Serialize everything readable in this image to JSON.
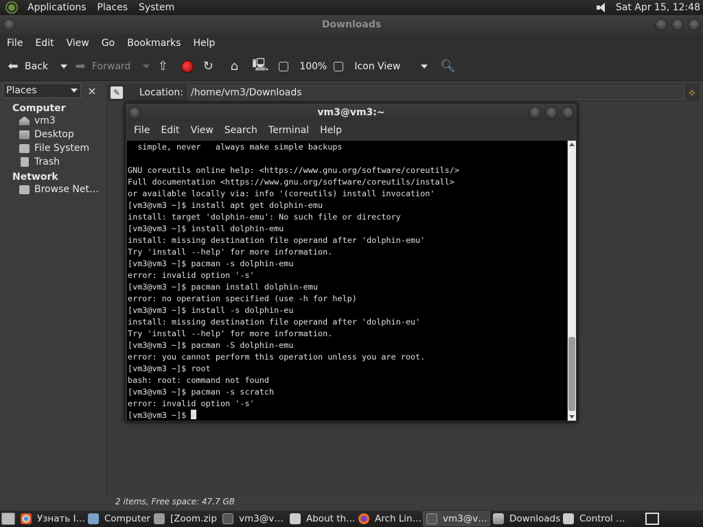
{
  "top_panel": {
    "menus": [
      "Applications",
      "Places",
      "System"
    ],
    "clock": "Sat Apr 15, 12:48"
  },
  "file_manager": {
    "title": "Downloads",
    "menus": [
      "File",
      "Edit",
      "View",
      "Go",
      "Bookmarks",
      "Help"
    ],
    "toolbar": {
      "back": "Back",
      "forward": "Forward",
      "zoom": "100%",
      "view_mode": "Icon View"
    },
    "sidebar": {
      "selector": "Places",
      "close": "×",
      "sections": [
        {
          "title": "Computer",
          "items": [
            "vm3",
            "Desktop",
            "File System",
            "Trash"
          ]
        },
        {
          "title": "Network",
          "items": [
            "Browse Net…"
          ]
        }
      ]
    },
    "location": {
      "label": "Location:",
      "path": "/home/vm3/Downloads"
    },
    "status": "2 items, Free space: 47.7 GB"
  },
  "terminal": {
    "title": "vm3@vm3:~",
    "menus": [
      "File",
      "Edit",
      "View",
      "Search",
      "Terminal",
      "Help"
    ],
    "lines": [
      "  simple, never   always make simple backups",
      "",
      "GNU coreutils online help: <https://www.gnu.org/software/coreutils/>",
      "Full documentation <https://www.gnu.org/software/coreutils/install>",
      "or available locally via: info '(coreutils) install invocation'",
      "[vm3@vm3 ~]$ install apt get dolphin-emu",
      "install: target 'dolphin-emu': No such file or directory",
      "[vm3@vm3 ~]$ install dolphin-emu",
      "install: missing destination file operand after 'dolphin-emu'",
      "Try 'install --help' for more information.",
      "[vm3@vm3 ~]$ pacman -s dolphin-emu",
      "error: invalid option '-s'",
      "[vm3@vm3 ~]$ pacman install dolphin-emu",
      "error: no operation specified (use -h for help)",
      "[vm3@vm3 ~]$ install -s dolphin-eu",
      "install: missing destination file operand after 'dolphin-eu'",
      "Try 'install --help' for more information.",
      "[vm3@vm3 ~]$ pacman -S dolphin-emu",
      "error: you cannot perform this operation unless you are root.",
      "[vm3@vm3 ~]$ root",
      "bash: root: command not found",
      "[vm3@vm3 ~]$ pacman -s scratch",
      "error: invalid option '-s'"
    ],
    "prompt": "[vm3@vm3 ~]$ "
  },
  "taskbar": {
    "tasks": [
      {
        "label": "Узнать I…",
        "icon": "chrome-icon",
        "color": "#e5b93a"
      },
      {
        "label": "Computer",
        "icon": "computer-icon",
        "color": "#7aa0c8"
      },
      {
        "label": "[Zoom.zip ]",
        "icon": "archive-icon",
        "color": "#9a9a9a"
      },
      {
        "label": "vm3@v…",
        "icon": "terminal-icon",
        "color": "#555555"
      },
      {
        "label": "About th…",
        "icon": "info-icon",
        "color": "#cccccc"
      },
      {
        "label": "Arch Lin…",
        "icon": "firefox-icon",
        "color": "#e8702a"
      },
      {
        "label": "vm3@v…",
        "icon": "terminal-icon",
        "color": "#555555"
      },
      {
        "label": "Downloads",
        "icon": "folder-icon",
        "color": "#b0b0b0"
      },
      {
        "label": "Control …",
        "icon": "control-icon",
        "color": "#cccccc"
      }
    ]
  }
}
